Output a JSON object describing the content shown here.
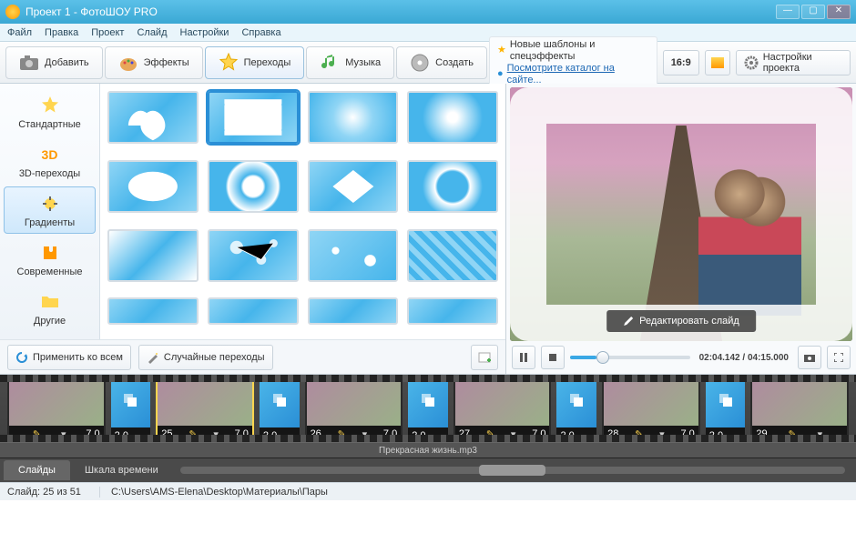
{
  "window": {
    "title": "Проект 1 - ФотоШОУ PRO"
  },
  "menu": [
    "Файл",
    "Правка",
    "Проект",
    "Слайд",
    "Настройки",
    "Справка"
  ],
  "toolbar": {
    "add": "Добавить",
    "effects": "Эффекты",
    "transitions": "Переходы",
    "music": "Музыка",
    "create": "Создать",
    "info1": "Новые шаблоны и спецэффекты",
    "info2": "Посмотрите каталог на сайте...",
    "ratio": "16:9",
    "settings": "Настройки проекта"
  },
  "cats": {
    "std": "Стандартные",
    "d3": "3D-переходы",
    "grad": "Градиенты",
    "modern": "Современные",
    "other": "Другие"
  },
  "grid_actions": {
    "apply_all": "Применить ко всем",
    "random": "Случайные переходы"
  },
  "preview": {
    "edit": "Редактировать слайд",
    "time": "02:04.142 / 04:15.000"
  },
  "timeline": {
    "slides": [
      {
        "n": "",
        "dur": "7.0"
      },
      {
        "trans": "2.0"
      },
      {
        "n": "25",
        "dur": "7.0",
        "sel": true
      },
      {
        "trans": "2.0"
      },
      {
        "n": "26",
        "dur": "7.0"
      },
      {
        "trans": "2.0"
      },
      {
        "n": "27",
        "dur": "7.0"
      },
      {
        "trans": "2.0"
      },
      {
        "n": "28",
        "dur": "7.0"
      },
      {
        "trans": "2.0"
      },
      {
        "n": "29",
        "dur": ""
      }
    ],
    "audio": "Прекрасная жизнь.mp3",
    "tab_slides": "Слайды",
    "tab_timeline": "Шкала времени"
  },
  "status": {
    "pos": "Слайд: 25 из 51",
    "path": "C:\\Users\\AMS-Elena\\Desktop\\Материалы\\Пары"
  }
}
